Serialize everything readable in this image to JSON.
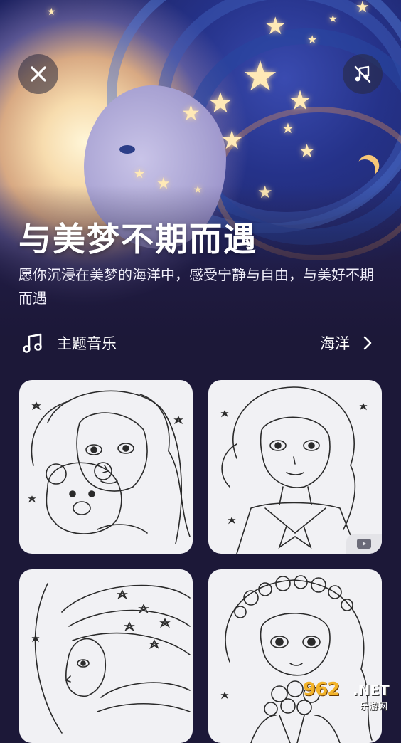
{
  "header": {
    "title": "与美梦不期而遇",
    "subtitle": "愿你沉浸在美梦的海洋中，感受宁静与自由，与美好不期而遇"
  },
  "controls": {
    "close_icon": "close-icon",
    "music_toggle_icon": "music-off-icon"
  },
  "music": {
    "label": "主题音乐",
    "value": "海洋",
    "icon": "music-note-icon"
  },
  "gallery": {
    "items": [
      {
        "subject": "curly-hair-girl-with-teddy-bear",
        "video": false
      },
      {
        "subject": "wavy-hair-girl-in-sailor-collar",
        "video": true
      },
      {
        "subject": "girl-with-stars-and-moon",
        "video": false
      },
      {
        "subject": "girl-with-flower-crown-and-bouquet",
        "video": false
      }
    ]
  },
  "watermark": {
    "number": "962",
    "domain": ".NET",
    "name": "乐游网"
  },
  "colors": {
    "background": "#1c1838",
    "card": "#f1f1f4",
    "accent_star": "#ffe9b6"
  }
}
